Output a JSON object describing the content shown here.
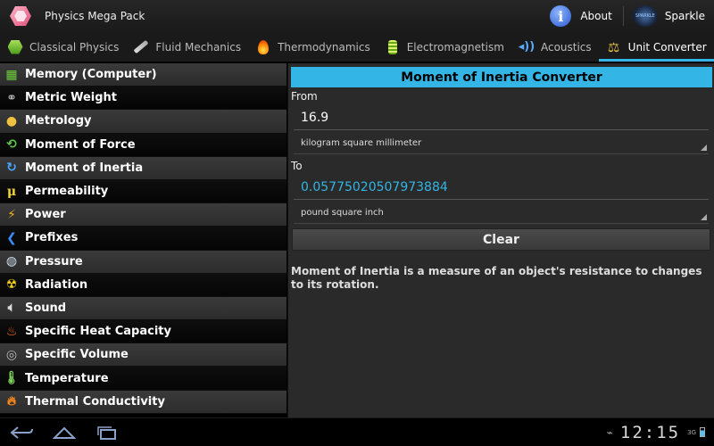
{
  "app": {
    "title": "Physics Mega Pack"
  },
  "actionbar": {
    "about_label": "About",
    "sparkle_label": "Sparkle",
    "sparkle_logo_text": "SPARKLE"
  },
  "tabs": [
    {
      "label": "Classical Physics",
      "icon": "hexagon-icon"
    },
    {
      "label": "Fluid Mechanics",
      "icon": "syringe-icon"
    },
    {
      "label": "Thermodynamics",
      "icon": "flame-icon"
    },
    {
      "label": "Electromagnetism",
      "icon": "bulb-icon"
    },
    {
      "label": "Acoustics",
      "icon": "sound-wave-icon"
    },
    {
      "label": "Unit Converter",
      "icon": "scale-icon",
      "active": true
    }
  ],
  "list": {
    "items": [
      {
        "label": "Memory (Computer)",
        "icon": "memory-icon"
      },
      {
        "label": "Metric Weight",
        "icon": "weight-icon"
      },
      {
        "label": "Metrology",
        "icon": "metrology-icon"
      },
      {
        "label": "Moment of Force",
        "icon": "force-icon"
      },
      {
        "label": "Moment of Inertia",
        "icon": "inertia-icon"
      },
      {
        "label": "Permeability",
        "icon": "mu-icon"
      },
      {
        "label": "Power",
        "icon": "lightning-icon"
      },
      {
        "label": "Prefixes",
        "icon": "chevron-left-icon"
      },
      {
        "label": "Pressure",
        "icon": "gauge-icon"
      },
      {
        "label": "Radiation",
        "icon": "radiation-icon"
      },
      {
        "label": "Sound",
        "icon": "speaker-icon"
      },
      {
        "label": "Specific Heat Capacity",
        "icon": "fire-icon"
      },
      {
        "label": "Specific Volume",
        "icon": "volume-icon"
      },
      {
        "label": "Temperature",
        "icon": "thermometer-icon"
      },
      {
        "label": "Thermal Conductivity",
        "icon": "flame-icon"
      }
    ]
  },
  "converter": {
    "header": "Moment of Inertia Converter",
    "from_label": "From",
    "from_value": "16.9",
    "from_unit": "kilogram square millimeter",
    "to_label": "To",
    "to_value": "0.0577502050797388 4",
    "to_value_exact": "0.05775020507973884",
    "to_unit": "pound square inch",
    "clear_label": "Clear",
    "description": "Moment of Inertia is a measure of an object's resistance to changes to its rotation."
  },
  "system": {
    "clock": "12:15",
    "network": "3G"
  },
  "colors": {
    "accent": "#33b5e5",
    "panel": "#2a2a2a"
  }
}
